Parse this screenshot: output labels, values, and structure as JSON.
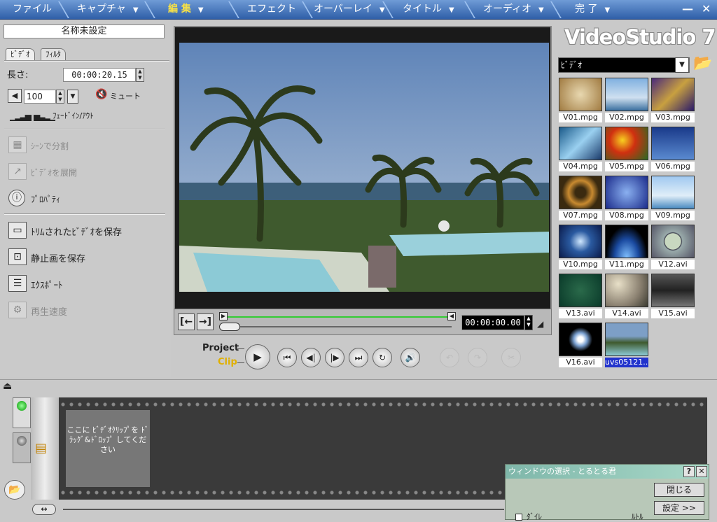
{
  "menu": {
    "items": [
      "ファイル",
      "キャプチャ",
      "編 集",
      "エフェクト",
      "オーバーレイ",
      "タイトル",
      "オーディオ",
      "完 了"
    ],
    "arrow": "▼",
    "minimize": "—",
    "close": "✕"
  },
  "left": {
    "project_name": "名称未設定",
    "tabs": [
      "ﾋﾞﾃﾞｵ",
      "ﾌｨﾙﾀ"
    ],
    "duration_label": "長さ:",
    "duration_value": "00:00:20.15",
    "volume": "100",
    "mute_label": "ミュート",
    "fade_label": "ﾌｪｰﾄﾞｲﾝ/ｱｳﾄ",
    "split_scene": "ｼｰﾝで分割",
    "expand_video": "ﾋﾞﾃﾞｵを展開",
    "properties": "ﾌﾟﾛﾊﾟﾃｨ",
    "save_trimmed": "ﾄﾘﾑされたﾋﾞﾃﾞｵを保存",
    "save_still": "静止画を保存",
    "export": "ｴｸｽﾎﾟｰﾄ",
    "playback_speed": "再生速度"
  },
  "preview": {
    "timecode": "00:00:00.00",
    "project_label": "Project",
    "clip_label": "Clip"
  },
  "library": {
    "title": "VideoStudio 7",
    "category": "ﾋﾞﾃﾞｵ",
    "items": [
      "V01.mpg",
      "V02.mpg",
      "V03.mpg",
      "V04.mpg",
      "V05.mpg",
      "V06.mpg",
      "V07.mpg",
      "V08.mpg",
      "V09.mpg",
      "V10.mpg",
      "V11.mpg",
      "V12.avi",
      "V13.avi",
      "V14.avi",
      "V15.avi",
      "V16.avi",
      "uvs05121..."
    ]
  },
  "timeline": {
    "drop_hint": "ここに ﾋﾞﾃﾞｵｸﾘｯﾌﾟを ﾄﾞﾗｯｸﾞ&ﾄﾞﾛｯﾌﾟ してください"
  },
  "dialog": {
    "title": "ウィンドウの選択 - とるとる君",
    "help": "?",
    "close": "✕",
    "close_button": "閉じる",
    "settings_button": "設定 >>",
    "check_label": "ﾀﾞｲﾚ",
    "right_label": "ﾙﾄﾙ"
  }
}
